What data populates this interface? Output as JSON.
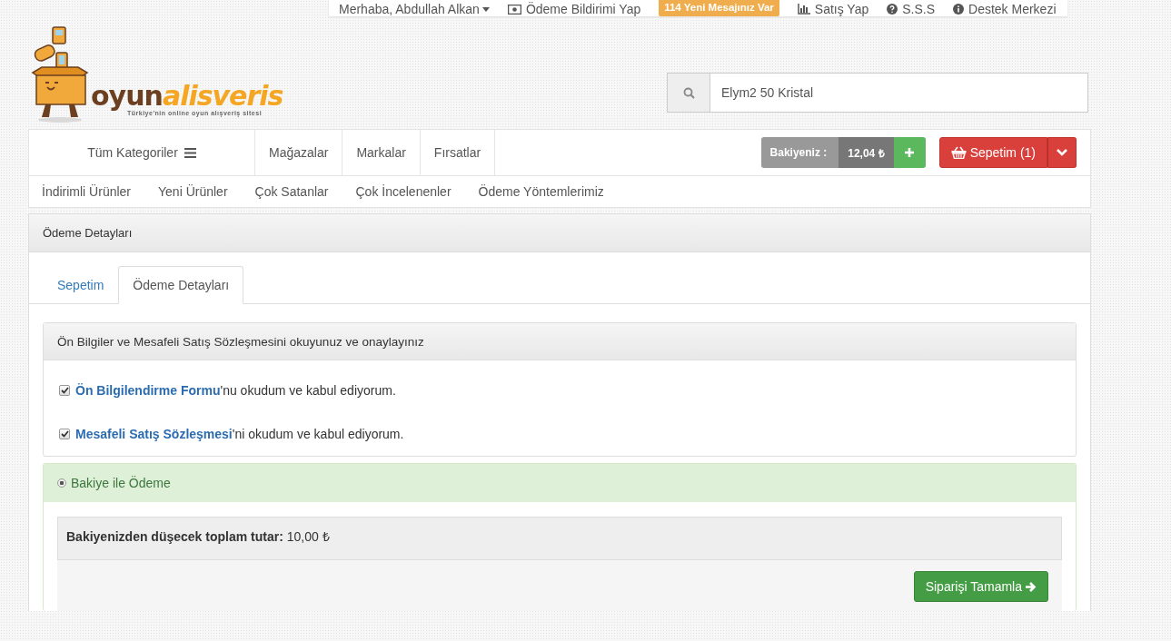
{
  "top_bar": {
    "greeting": "Merhaba, Abdullah Alkan",
    "payment_notice": "Ödeme Bildirimi Yap",
    "messages_badge": "114 Yeni Mesajınız Var",
    "sell": "Satış Yap",
    "faq": "S.S.S",
    "support": "Destek Merkezi"
  },
  "logo": {
    "word_1": "oyun",
    "word_2": "alisveris",
    "tagline": "Türkiye'nin online oyun alışveriş sitesi"
  },
  "search": {
    "value": "Elym2 50 Kristal"
  },
  "nav": {
    "categories": "Tüm Kategoriler",
    "links": [
      "Mağazalar",
      "Markalar",
      "Fırsatlar"
    ],
    "balance_label": "Bakiyeniz :",
    "balance_amount": "12,04 ₺",
    "cart": "Sepetim (1)"
  },
  "sub_nav": [
    "İndirimli Ürünler",
    "Yeni Ürünler",
    "Çok Satanlar",
    "Çok İncelenenler",
    "Ödeme Yöntemlerimiz"
  ],
  "panel": {
    "title": "Ödeme Detayları",
    "tabs": [
      {
        "label": "Sepetim",
        "selected": false
      },
      {
        "label": "Ödeme Detayları",
        "selected": true
      }
    ],
    "agreements": {
      "heading": "Ön Bilgiler ve Mesafeli Satış Sözleşmesini okuyunuz ve onaylayınız",
      "items": [
        {
          "link": "Ön Bilgilendirme Formu",
          "rest": "'nu okudum ve kabul ediyorum.",
          "checked": true
        },
        {
          "link": "Mesafeli Satış Sözleşmesi",
          "rest": "'ni okudum ve kabul ediyorum.",
          "checked": true
        }
      ]
    },
    "payment": {
      "label": "Bakiye ile Ödeme",
      "selected": true,
      "total_label": "Bakiyenizden düşecek toplam tutar:",
      "total_value": "10,00 ₺",
      "submit": "Siparişi Tamamla"
    }
  }
}
